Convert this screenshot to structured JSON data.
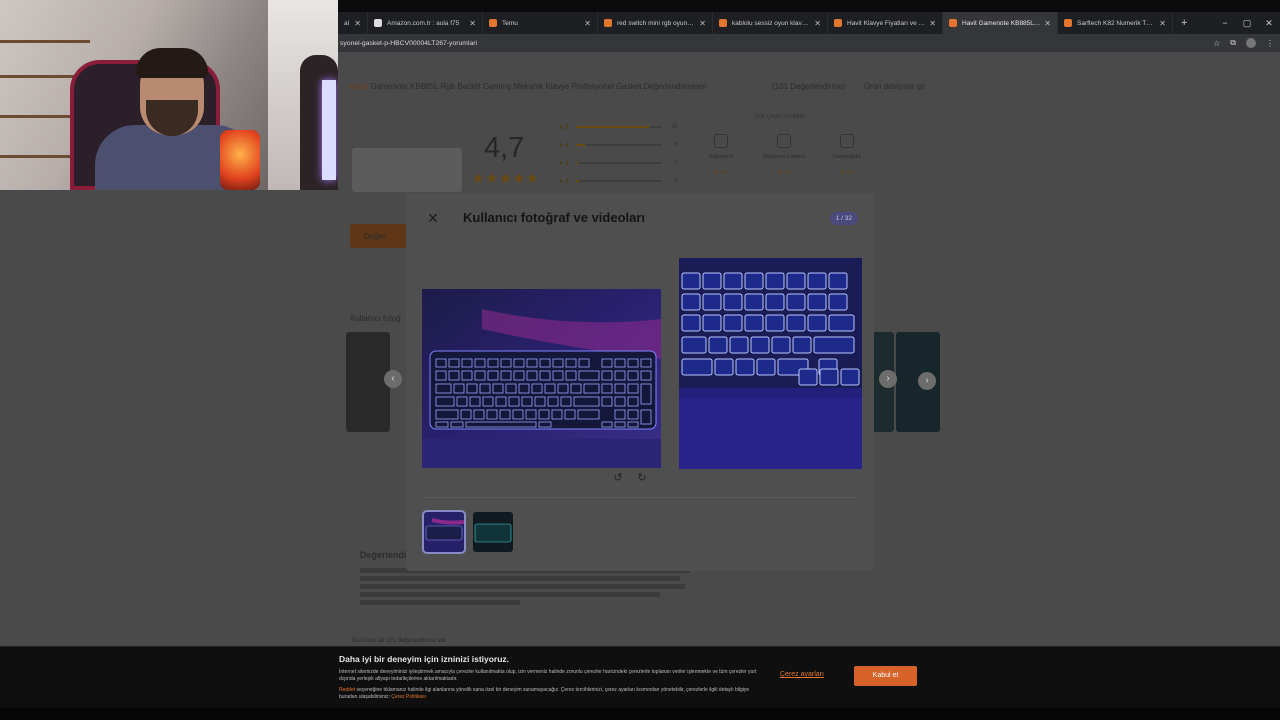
{
  "browser": {
    "tabs": [
      {
        "label": "al",
        "fav": "#e3762e",
        "active": false
      },
      {
        "label": "Amazon.com.tr : aula f75",
        "fav": "#ddd",
        "active": false
      },
      {
        "label": "Temu",
        "fav": "#e3762e",
        "active": false
      },
      {
        "label": "red switch mini rgb oyun klav",
        "fav": "#e3762e",
        "active": false
      },
      {
        "label": "kablolu sessiz oyun klavyesi m",
        "fav": "#e3762e",
        "active": false
      },
      {
        "label": "Havit Klavye Fiyatları ve Mode",
        "fav": "#e3762e",
        "active": false
      },
      {
        "label": "Havit Gamenote KB885L Rgb",
        "fav": "#e3762e",
        "active": true
      },
      {
        "label": "Sarftech K82 Numerik Tuş Sa",
        "fav": "#e3762e",
        "active": false
      }
    ],
    "new_tab": "+",
    "window_controls": [
      "−",
      "▢",
      "✕"
    ],
    "url": "syonel-gasket-p-HBCV00004LT267-yorumlari"
  },
  "page": {
    "brand": "Havit",
    "product_title": "Gamenote KB885L Rgb Backlit Gaming Mekanik Klavye Profesyonel Gasket Değerlendirmeleri",
    "review_count_label": "(101 Değerlendirme)",
    "go_to_product": "Ürün detayına git",
    "rating": "4,7",
    "stars": "★★★★★",
    "rating_bars": [
      {
        "label": "★ 5",
        "value": 0.85,
        "count": "90"
      },
      {
        "label": "★ 4",
        "value": 0.1,
        "count": "6"
      },
      {
        "label": "★ 3",
        "value": 0.02,
        "count": "1"
      },
      {
        "label": "★ 2",
        "value": 0.03,
        "count": "2"
      }
    ],
    "features_title": "Öne çıkan özellikler",
    "features": [
      {
        "label": "Ergonomi",
        "value": "★ 4,6"
      },
      {
        "label": "Malzeme Kalitesi",
        "value": "★ 4,7"
      },
      {
        "label": "Dayanıklılık",
        "value": "★ 4,5"
      }
    ],
    "review_button": "Değer",
    "user_photos_heading": "Kullanıcı fotoğ",
    "description_heading": "Değerlendi",
    "reviews_footer": "Bu ürüne ait 101 değerlendirme var"
  },
  "modal": {
    "title": "Kullanıcı fotoğraf ve videoları",
    "counter": "1 / 32",
    "close_icon": "close-icon",
    "rotate_left_icon": "rotate-left-icon",
    "rotate_right_icon": "rotate-right-icon"
  },
  "cookie": {
    "title": "Daha iyi bir deneyim için izninizi istiyoruz.",
    "text1": "İnternet sitemizde deneyiminizi iyileştirmek amacıyla çerezler kullanılmakta olup, izin vermeniz halinde zorunlu çerezler haricindeki çerezlerle toplanan veriler işlenmekte ve tüm çerezler yurt dışında yerleşik altyapı tedarikçilerine aktarılmaktadır.",
    "text2_link": "Reddet",
    "text2": " seçeneğine tıklamanız halinde ilgi alanlarına yönelik sana özel bir deneyim sunamayacağız. Çerez tercihlerinizi, çerez ayarları kısmından yönetebilir, çerezlerle ilgili detaylı bilgiye buradan ulaşabilirsiniz: ",
    "policy_link": "Çerez Politikası",
    "settings_label": "Çerez ayarları",
    "accept_label": "Kabul et",
    "accent": "#d7622a"
  }
}
